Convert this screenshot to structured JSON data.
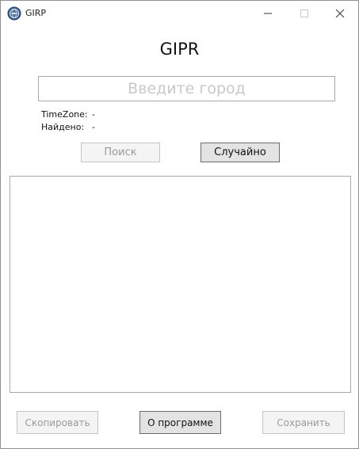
{
  "window": {
    "title": "GIRP",
    "icon": "globe-icon"
  },
  "controls": {
    "minimize": "minimize-icon",
    "maximize": "maximize-icon",
    "close": "close-icon"
  },
  "main": {
    "heading": "GIPR",
    "city_input": {
      "placeholder": "Введите город",
      "value": ""
    },
    "timezone_label": "TimeZone:",
    "timezone_value": "-",
    "found_label": "Найдено:",
    "found_value": "-",
    "search_label": "Поиск",
    "random_label": "Случайно"
  },
  "footer": {
    "copy_label": "Скопировать",
    "about_label": "О программе",
    "save_label": "Сохранить"
  },
  "colors": {
    "disabled_text": "#9a9a9a",
    "button_face": "#e3e3e3",
    "border": "#a8a8a8"
  }
}
